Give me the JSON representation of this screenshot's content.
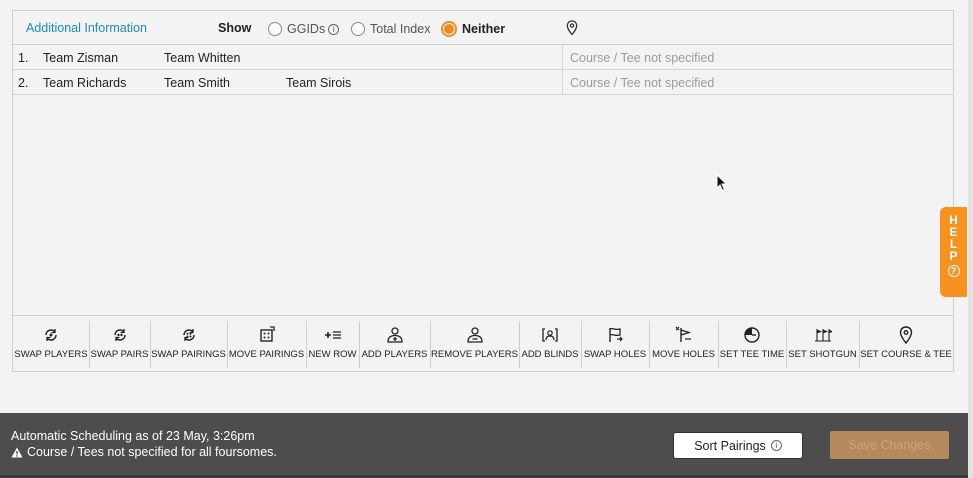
{
  "header": {
    "additional_info": "Additional Information",
    "show_label": "Show",
    "options": [
      {
        "label": "GGIDs",
        "selected": false,
        "has_info": true
      },
      {
        "label": "Total Index",
        "selected": false,
        "has_info": false
      },
      {
        "label": "Neither",
        "selected": true,
        "has_info": false
      }
    ],
    "info_glyph": "i",
    "location_icon": "map-pin-icon"
  },
  "pairings": [
    {
      "num": "1.",
      "teams": [
        "Team Zisman",
        "Team Whitten",
        ""
      ],
      "course": "Course / Tee not specified"
    },
    {
      "num": "2.",
      "teams": [
        "Team Richards",
        "Team Smith",
        "Team Sirois"
      ],
      "course": "Course / Tee not specified"
    }
  ],
  "toolbar": [
    {
      "label": "SWAP PLAYERS",
      "icon": "swap-players-icon"
    },
    {
      "label": "SWAP PAIRS",
      "icon": "swap-pairs-icon"
    },
    {
      "label": "SWAP PAIRINGS",
      "icon": "swap-pairings-icon"
    },
    {
      "label": "MOVE PAIRINGS",
      "icon": "move-pairings-icon"
    },
    {
      "label": "NEW ROW",
      "icon": "new-row-icon"
    },
    {
      "label": "ADD PLAYERS",
      "icon": "add-players-icon"
    },
    {
      "label": "REMOVE PLAYERS",
      "icon": "remove-players-icon"
    },
    {
      "label": "ADD BLINDS",
      "icon": "add-blinds-icon"
    },
    {
      "label": "SWAP HOLES",
      "icon": "swap-holes-icon"
    },
    {
      "label": "MOVE HOLES",
      "icon": "move-holes-icon"
    },
    {
      "label": "SET TEE TIME",
      "icon": "tee-time-icon"
    },
    {
      "label": "SET SHOTGUN",
      "icon": "shotgun-icon"
    },
    {
      "label": "SET COURSE & TEE",
      "icon": "course-pin-icon"
    }
  ],
  "help": {
    "letters": [
      "H",
      "E",
      "L",
      "P"
    ],
    "glyph": "?"
  },
  "footer": {
    "schedule_text": "Automatic Scheduling as of 23 May, 3:26pm",
    "warning_text": "Course / Tees not specified for all foursomes.",
    "sort_label": "Sort Pairings",
    "save_label": "Save Changes"
  },
  "colors": {
    "accent": "#f08a20",
    "link": "#1f8bc5",
    "footer_bg": "#4d4d4d",
    "save_btn": "#b58a5c"
  }
}
